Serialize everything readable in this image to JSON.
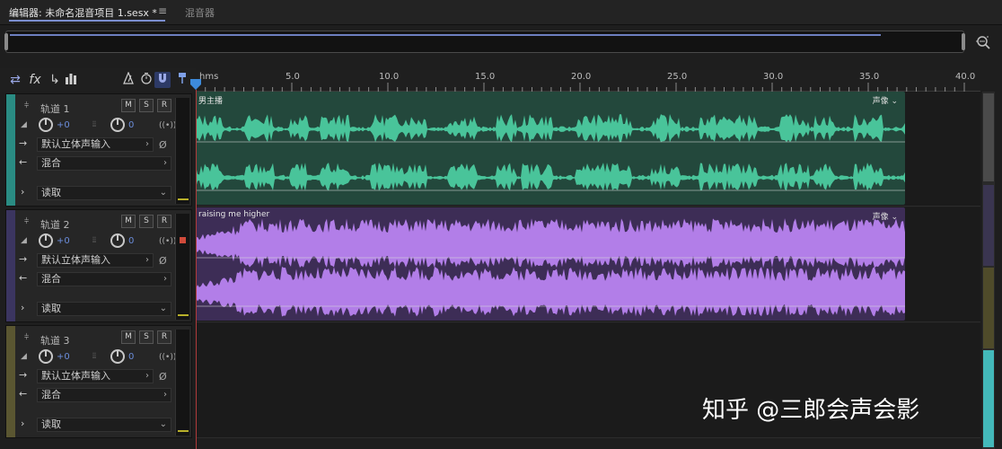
{
  "tabs": {
    "editor_label": "编辑器: 未命名混音项目 1.sesx *",
    "menu_icon": "≡",
    "mixer_label": "混音器"
  },
  "icons": {
    "toolbar": [
      "swap-icon",
      "fx-icon",
      "send-icon",
      "meter-bars-icon",
      "metronome-icon",
      "timer-icon",
      "snap-magnet-icon",
      "marker-pin-icon"
    ],
    "zoom": "zoom-icon"
  },
  "ruler": {
    "unit": "hms",
    "labels": [
      "5.0",
      "10.0",
      "15.0",
      "20.0",
      "25.0",
      "30.0",
      "35.0",
      "40.0"
    ]
  },
  "tracks": [
    {
      "name": "轨道 1",
      "color": "#2a8c83",
      "m": "M",
      "s": "S",
      "r": "R",
      "volume": "+0",
      "pan": "0",
      "input": "默认立体声输入",
      "output": "混合",
      "automation": "读取",
      "clip": {
        "name": "男主播",
        "pan_label": "声像",
        "color": "#23483c",
        "wave": "#49c49a",
        "end_seconds": 36.9
      }
    },
    {
      "name": "轨道 2",
      "color": "#3b3560",
      "m": "M",
      "s": "S",
      "r": "R",
      "volume": "+0",
      "pan": "0",
      "input": "默认立体声输入",
      "output": "混合",
      "automation": "读取",
      "clip": {
        "name": "raising me higher",
        "pan_label": "声像",
        "color": "#3d2d56",
        "wave": "#b27ee8",
        "end_seconds": 36.9
      }
    },
    {
      "name": "轨道 3",
      "color": "#5a5631",
      "m": "M",
      "s": "S",
      "r": "R",
      "volume": "+0",
      "pan": "0",
      "input": "默认立体声输入",
      "output": "混合",
      "automation": "读取"
    }
  ],
  "watermark": "知乎 @三郎会声会影"
}
